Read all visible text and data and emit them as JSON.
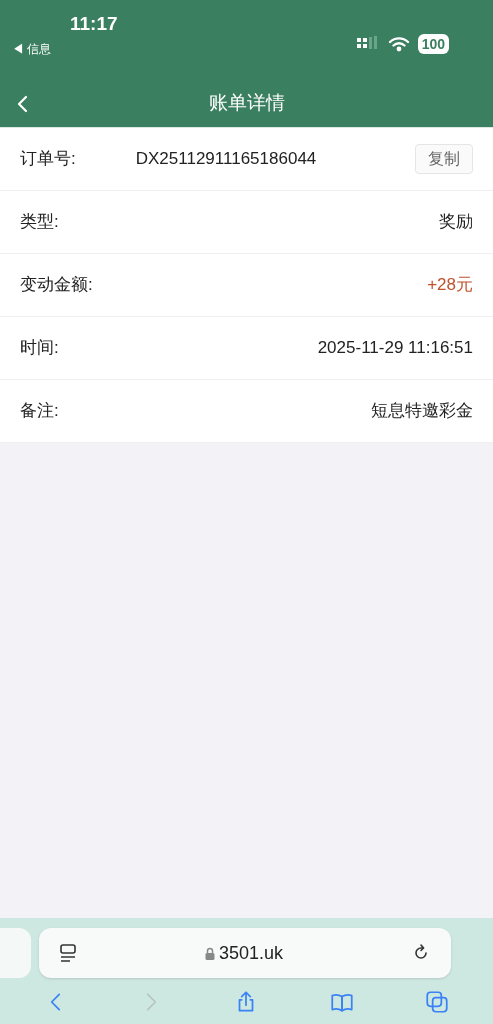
{
  "status_bar": {
    "time": "11:17",
    "back_app": "◀ 信息",
    "battery": "100"
  },
  "nav": {
    "title": "账单详情"
  },
  "rows": [
    {
      "kind": "copyable",
      "label": "订单号:",
      "value": "DX25112911165186044",
      "action": "复制"
    },
    {
      "kind": "plain",
      "label": "类型:",
      "value": "奖励"
    },
    {
      "kind": "amount",
      "label": "变动金额:",
      "value": "+28元"
    },
    {
      "kind": "plain",
      "label": "时间:",
      "value": "2025-11-29 11:16:51"
    },
    {
      "kind": "plain",
      "label": "备注:",
      "value": "短息特邀彩金"
    }
  ],
  "browser": {
    "url": "3501.uk",
    "toolbar": [
      {
        "kind": "back",
        "disabled": false
      },
      {
        "kind": "forward",
        "disabled": true
      },
      {
        "kind": "share",
        "disabled": false
      },
      {
        "kind": "bookmarks",
        "disabled": false
      },
      {
        "kind": "tabs",
        "disabled": false
      }
    ]
  }
}
